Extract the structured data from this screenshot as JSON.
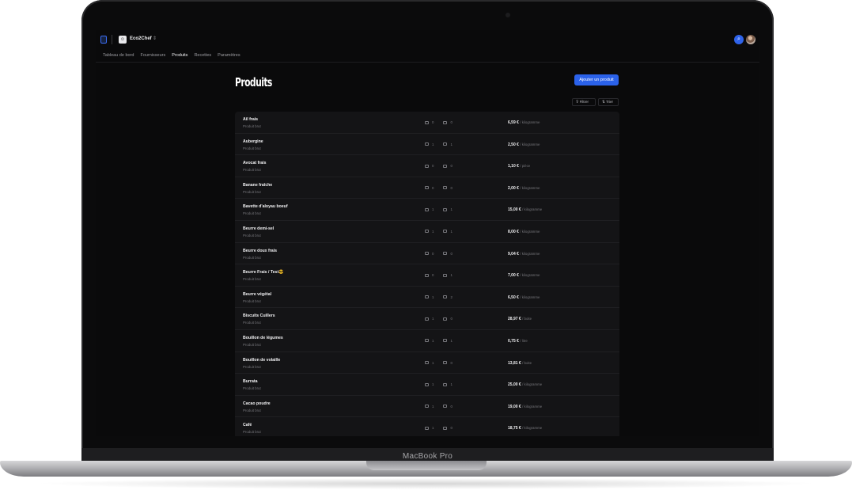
{
  "device": {
    "label": "MacBook Pro"
  },
  "workspace": {
    "name": "Eco2Chef",
    "logo_icon": "chef-hat-icon"
  },
  "tabs": [
    {
      "label": "Tableau de bord",
      "active": false
    },
    {
      "label": "Fournisseurs",
      "active": false
    },
    {
      "label": "Produits",
      "active": true
    },
    {
      "label": "Recettes",
      "active": false
    },
    {
      "label": "Paramètres",
      "active": false
    }
  ],
  "header": {
    "title": "Produits",
    "add_label": "Ajouter un produit",
    "filter_label": "Filtrer",
    "sort_label": "Trier"
  },
  "colors": {
    "accent": "#2b62ea",
    "background": "#0a0a0b",
    "card": "#141416"
  },
  "products": [
    {
      "name": "Ail frais",
      "type": "Produit brut",
      "recipes": "0",
      "suppliers": "0",
      "price": "6,59 €",
      "unit": "/ kilogramme"
    },
    {
      "name": "Aubergine",
      "type": "Produit brut",
      "recipes": "1",
      "suppliers": "1",
      "price": "2,50 €",
      "unit": "/ kilogramme"
    },
    {
      "name": "Avocat frais",
      "type": "Produit brut",
      "recipes": "0",
      "suppliers": "0",
      "price": "1,10 €",
      "unit": "/ pièce"
    },
    {
      "name": "Banane fraîche",
      "type": "Produit brut",
      "recipes": "0",
      "suppliers": "0",
      "price": "2,00 €",
      "unit": "/ kilogramme"
    },
    {
      "name": "Bavette d'aloyau boeuf",
      "type": "Produit brut",
      "recipes": "1",
      "suppliers": "1",
      "price": "15,00 €",
      "unit": "/ kilogramme"
    },
    {
      "name": "Beurre demi-sel",
      "type": "Produit brut",
      "recipes": "1",
      "suppliers": "1",
      "price": "8,00 €",
      "unit": "/ kilogramme"
    },
    {
      "name": "Beurre doux frais",
      "type": "Produit brut",
      "recipes": "0",
      "suppliers": "0",
      "price": "9,04 €",
      "unit": "/ kilogramme"
    },
    {
      "name": "Beurre Frais / Test😎",
      "type": "Produit brut",
      "recipes": "0",
      "suppliers": "1",
      "price": "7,00 €",
      "unit": "/ kilogramme"
    },
    {
      "name": "Beurre végétal",
      "type": "Produit brut",
      "recipes": "1",
      "suppliers": "2",
      "price": "6,50 €",
      "unit": "/ kilogramme"
    },
    {
      "name": "Biscuits Cuillers",
      "type": "Produit brut",
      "recipes": "1",
      "suppliers": "0",
      "price": "28,97 €",
      "unit": "/ boite"
    },
    {
      "name": "Bouillon de légumes",
      "type": "Produit brut",
      "recipes": "1",
      "suppliers": "1",
      "price": "0,75 €",
      "unit": "/ litre"
    },
    {
      "name": "Bouillon de volaille",
      "type": "Produit brut",
      "recipes": "1",
      "suppliers": "0",
      "price": "13,81 €",
      "unit": "/ boite"
    },
    {
      "name": "Burrata",
      "type": "Produit brut",
      "recipes": "1",
      "suppliers": "1",
      "price": "25,00 €",
      "unit": "/ kilogramme"
    },
    {
      "name": "Cacao poudre",
      "type": "Produit brut",
      "recipes": "1",
      "suppliers": "0",
      "price": "19,00 €",
      "unit": "/ kilogramme"
    },
    {
      "name": "Café",
      "type": "Produit brut",
      "recipes": "1",
      "suppliers": "0",
      "price": "18,75 €",
      "unit": "/ kilogramme"
    }
  ]
}
